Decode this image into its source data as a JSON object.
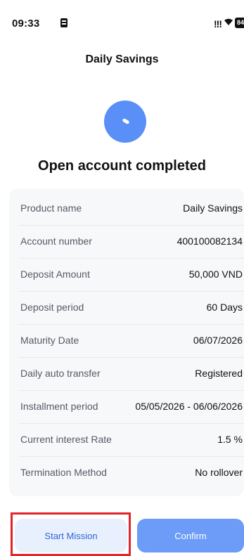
{
  "status_bar": {
    "time": "09:33",
    "signal": "!!!",
    "battery": "84"
  },
  "header": {
    "title": "Daily Savings"
  },
  "result": {
    "title": "Open account completed",
    "accent_color": "#5a8ff7"
  },
  "details": [
    {
      "label": "Product name",
      "value": "Daily Savings"
    },
    {
      "label": "Account number",
      "value": "400100082134"
    },
    {
      "label": "Deposit Amount",
      "value": "50,000 VND"
    },
    {
      "label": "Deposit period",
      "value": "60 Days"
    },
    {
      "label": "Maturity Date",
      "value": "06/07/2026"
    },
    {
      "label": "Daily auto transfer",
      "value": "Registered"
    },
    {
      "label": "Installment period",
      "value": "05/05/2026 - 06/06/2026"
    },
    {
      "label": "Current interest Rate",
      "value": "1.5 %"
    },
    {
      "label": "Termination Method",
      "value": "No rollover"
    }
  ],
  "actions": {
    "start_mission_label": "Start Mission",
    "confirm_label": "Confirm",
    "highlight_color": "#e0242a"
  }
}
